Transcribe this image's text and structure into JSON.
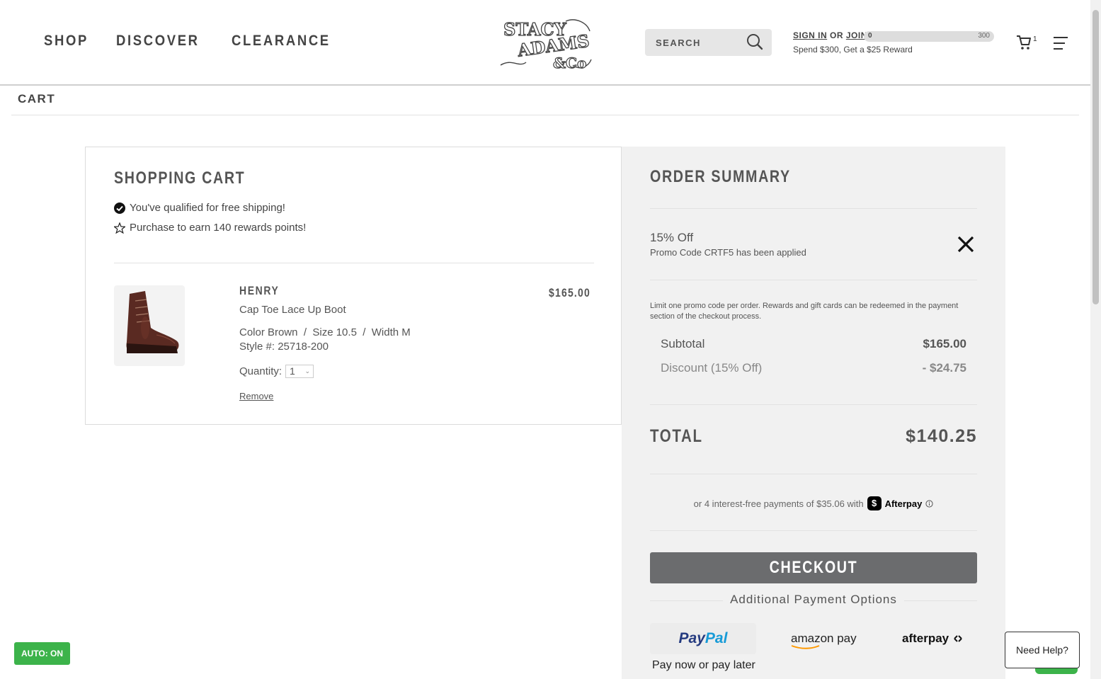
{
  "header": {
    "nav": [
      "SHOP",
      "DISCOVER",
      "CLEARANCE"
    ],
    "logo_text": [
      "STACY",
      "ADAMS",
      "&Co"
    ],
    "search_placeholder": "SEARCH",
    "sign_in": "SIGN IN",
    "or": "OR",
    "join": "JOIN",
    "progress_min": "0",
    "progress_max": "300",
    "reward_text": "Spend $300, Get a $25 Reward",
    "cart_count": "1"
  },
  "breadcrumb": "CART",
  "cart": {
    "title": "SHOPPING CART",
    "free_shipping": "You've qualified for free shipping!",
    "rewards": "Purchase to earn 140 rewards points!",
    "item": {
      "name": "HENRY",
      "description": "Cap Toe Lace Up Boot",
      "attributes": "Color Brown  /  Size 10.5  /  Width M",
      "style": "Style #: 25718-200",
      "quantity_label": "Quantity:",
      "quantity": "1",
      "remove": "Remove",
      "price": "$165.00"
    }
  },
  "summary": {
    "title": "ORDER SUMMARY",
    "promo_title": "15% Off",
    "promo_sub": "Promo Code CRTF5 has been applied",
    "limit_note": "Limit one promo code per order. Rewards and gift cards can be redeemed in the payment section of the checkout process.",
    "subtotal_label": "Subtotal",
    "subtotal_value": "$165.00",
    "discount_label": "Discount (15% Off)",
    "discount_value": "- $24.75",
    "total_label": "TOTAL",
    "total_value": "$140.25",
    "afterpay_text": "or 4 interest-free payments of $35.06 with",
    "afterpay_badge": "$",
    "afterpay_brand": "Afterpay",
    "checkout": "CHECKOUT",
    "additional": "Additional Payment Options",
    "paypal_pay": "Pay",
    "paypal_pal": "Pal",
    "paypal_later": "Pay now or pay later",
    "amazon_pay": "amazon pay",
    "afterpay_logo": "afterpay"
  },
  "widgets": {
    "auto": "AUTO: ON",
    "help": "Need Help?"
  },
  "colors": {
    "checkout_bg": "#6b6c6e",
    "summary_bg": "#f1f1f1",
    "auto_green": "#3cb34a",
    "paypal_dark": "#253b80",
    "paypal_light": "#179bd7",
    "amazon_orange": "#f90"
  }
}
